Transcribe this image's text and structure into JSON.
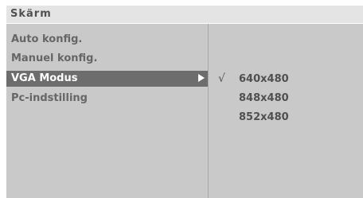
{
  "title": "Skärm",
  "menu": {
    "items": [
      {
        "label": "Auto konfig."
      },
      {
        "label": "Manuel konfig."
      },
      {
        "label": "VGA Modus",
        "selected": true,
        "has_submenu": true
      },
      {
        "label": "Pc-indstilling"
      }
    ]
  },
  "submenu": {
    "check_mark": "√",
    "options": [
      {
        "label": "640x480",
        "checked": true
      },
      {
        "label": "848x480"
      },
      {
        "label": "852x480"
      }
    ]
  },
  "colors": {
    "panel": "#c9c9c9",
    "title_bar": "#e4e4e4",
    "highlight": "#6d6d6d",
    "text": "#666666"
  },
  "icons": {
    "submenu_arrow": "triangle-right-icon"
  }
}
